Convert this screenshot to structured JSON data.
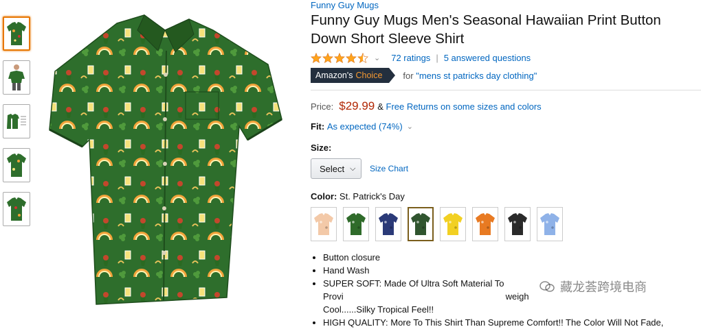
{
  "brand": "Funny Guy Mugs",
  "title_line1": "Funny Guy Mugs Men's Seasonal Hawaiian Print Button",
  "title_line2": "Down Short Sleeve Shirt",
  "rating": {
    "stars": 4.5,
    "ratings": "72 ratings",
    "answered": "5 answered questions"
  },
  "choice": {
    "badge_a": "Amazon's",
    "badge_b": "Choice",
    "for_text": "for",
    "query": "\"mens st patricks day clothing\""
  },
  "price": {
    "label": "Price:",
    "value": "$29.99",
    "amp": "&",
    "returns": "Free Returns on some sizes and colors"
  },
  "fit": {
    "label": "Fit:",
    "value": "As expected (74%)"
  },
  "size": {
    "label": "Size:",
    "select": "Select",
    "chart": "Size Chart"
  },
  "color": {
    "label": "Color:",
    "value": "St. Patrick's Day"
  },
  "swatch_colors": [
    "#f3c9a8",
    "#2f6b2a",
    "#2b3a78",
    "#30552f",
    "#f2d022",
    "#e87a22",
    "#2a2a2a",
    "#8fb2e8"
  ],
  "bullets": [
    "Button closure",
    "Hand Wash",
    "SUPER SOFT: Made Of Ultra Soft Material To Provi",
    "Cool......Silky Tropical Feel!!",
    "HIGH QUALITY: More To This Shirt Than Supreme Comfort!! The Color Will Not Fade,"
  ],
  "bullet3_tail": "weigh",
  "watermark": "藏龙荟跨境电商",
  "colors": {
    "link": "#0066c0",
    "price": "#b12704",
    "shirt": "#2e6e2c",
    "badge": "#232f3e",
    "accent": "#e77600"
  }
}
